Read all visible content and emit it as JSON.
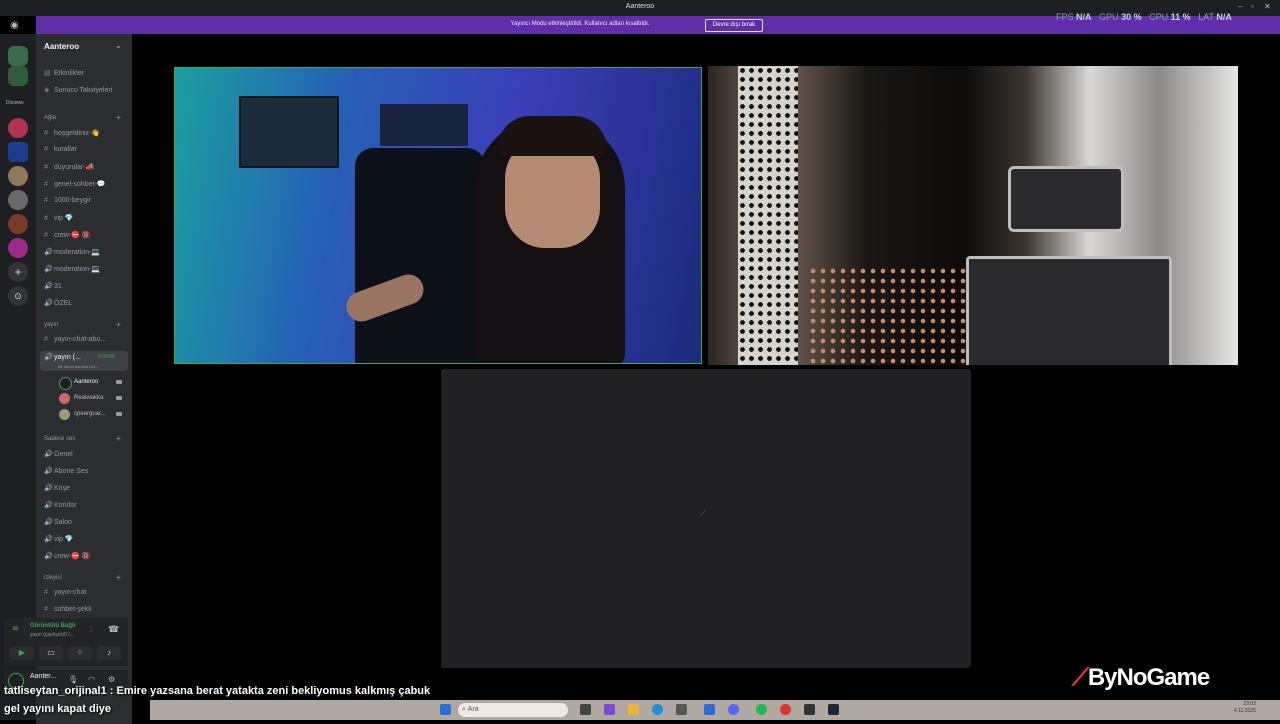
{
  "window": {
    "title": "Aanteroo"
  },
  "banner": {
    "text": "Yayıncı Modu etkinleştirildi. Kullanıcı adları kısaltıldı.",
    "button": "Devre dışı bırak"
  },
  "stats": {
    "fps_label": "FPS",
    "fps": "N/A",
    "gpu_label": "GPU",
    "gpu": "30 %",
    "cpu_label": "CPU",
    "cpu": "11 %",
    "lat_label": "LAT",
    "lat": "N/A"
  },
  "server_rail": {
    "folder_label": "Diıcews"
  },
  "guild": {
    "name": "Aanteroo"
  },
  "top_items": [
    {
      "label": "Etkinlikler"
    },
    {
      "label": "Sunucu Takviyeleri"
    }
  ],
  "categories": {
    "agla": "Ağla",
    "yayin": "yayın",
    "sadece_ses": "Sadece ses",
    "izleyici": "izleyici"
  },
  "text_channels": [
    {
      "label": "hoşgeldiniz-👋"
    },
    {
      "label": "kurallar"
    },
    {
      "label": "duyurular-📣"
    },
    {
      "label": "genel-sohbet-💬"
    },
    {
      "label": "1000-beygir"
    },
    {
      "label": "vip 💎"
    },
    {
      "label": "crew-⛔ 🔞"
    },
    {
      "label": "moderation-💻"
    },
    {
      "label": "moderation-💻"
    },
    {
      "label": "31"
    },
    {
      "label": "ÖZEL"
    }
  ],
  "yayin_channels": {
    "chat": "yayın-chat-abo...",
    "voice": "yayın (...",
    "voice_time": "5:03:49",
    "voice_status": "Bir kanal durumu bel...",
    "users": [
      {
        "name": "Aanteroo"
      },
      {
        "name": "Realwakka"
      },
      {
        "name": "spearguar..."
      }
    ]
  },
  "voice_channels": [
    {
      "label": "Genel"
    },
    {
      "label": "Abone Ses"
    },
    {
      "label": "Köşe"
    },
    {
      "label": "Koridor"
    },
    {
      "label": "Salon"
    },
    {
      "label": "vip 💎"
    },
    {
      "label": "crew-⛔ 🔞"
    }
  ],
  "izleyici_channels": [
    {
      "label": "yayın-chat"
    },
    {
      "label": "sohbet-şekli"
    }
  ],
  "voice_panel": {
    "status": "Görüntülü Bağlı",
    "sub": "yayın (çaylıyor)0 /..."
  },
  "user_panel": {
    "name": "Aanter..."
  },
  "chat_overlay": {
    "line1": "tatliseytan_orijinal1 : Emire yazsana berat yatakta zeni bekliyomus kalkmış çabuk",
    "line2": "gel yayını kapat diye"
  },
  "watermark": "ByNoGame",
  "taskbar": {
    "search_placeholder": "Ara",
    "time": "23:03",
    "date": "4.11.2025"
  },
  "colors": {
    "banner": "#5e2fa8",
    "connected": "#3ba55c",
    "sidebar": "#2b2d31"
  }
}
